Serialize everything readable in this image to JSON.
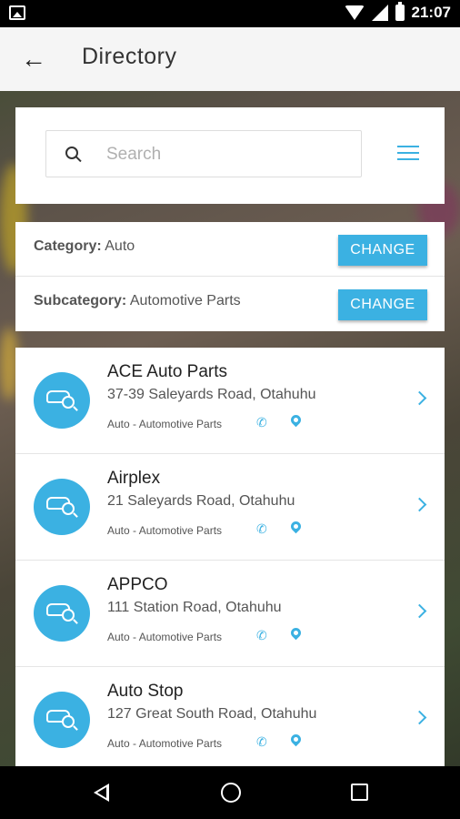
{
  "status_bar": {
    "time": "21:07"
  },
  "app_bar": {
    "title": "Directory"
  },
  "search": {
    "placeholder": "Search"
  },
  "filters": {
    "category_label": "Category:",
    "category_value": "Auto",
    "subcategory_label": "Subcategory:",
    "subcategory_value": "Automotive Parts",
    "change_label": "CHANGE"
  },
  "listings": [
    {
      "name": "ACE Auto Parts",
      "address": "37-39 Saleyards Road, Otahuhu",
      "category": "Auto - Automotive Parts"
    },
    {
      "name": "Airplex",
      "address": "21 Saleyards Road, Otahuhu",
      "category": "Auto - Automotive Parts"
    },
    {
      "name": "APPCO",
      "address": "111 Station Road, Otahuhu",
      "category": "Auto - Automotive Parts"
    },
    {
      "name": "Auto Stop",
      "address": "127 Great South Road, Otahuhu",
      "category": "Auto - Automotive Parts"
    }
  ],
  "colors": {
    "accent": "#3bb1e2",
    "app_bar": "#f5f5f5"
  },
  "icons": [
    "back-arrow-icon",
    "search-icon",
    "menu-icon",
    "car-search-icon",
    "phone-icon",
    "map-pin-icon",
    "chevron-right-icon"
  ]
}
